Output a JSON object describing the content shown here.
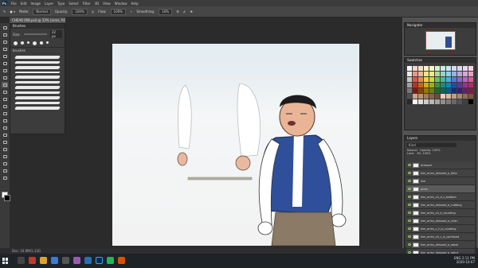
{
  "menu": {
    "app_icon": "Ps",
    "items": [
      "File",
      "Edit",
      "Image",
      "Layer",
      "Type",
      "Select",
      "Filter",
      "3D",
      "View",
      "Window",
      "Help"
    ]
  },
  "options": {
    "mode_label": "Mode:",
    "mode_value": "Normal",
    "opacity_label": "Opacity:",
    "opacity_value": "100%",
    "flow_label": "Flow:",
    "flow_value": "100%",
    "smoothing_label": "Smoothing:",
    "smoothing_value": "10%"
  },
  "document": {
    "tab_title": "CHEAB 008.psd @ 33% (arms, RGB/8)"
  },
  "brushes_panel": {
    "title": "Brushes",
    "size_label": "Size:",
    "size_value": "22 px",
    "folder_label": "brushes"
  },
  "navigator": {
    "title": "Navigator"
  },
  "swatches": {
    "title": "Swatches",
    "colors": [
      "#ffffff",
      "#f4d4cc",
      "#f8e0c8",
      "#fff4c0",
      "#f4f8c8",
      "#d8f0d0",
      "#c8ece4",
      "#c8e8f4",
      "#d0dcf4",
      "#dcd4f0",
      "#ecd4ec",
      "#f4d4e0",
      "#e8e8e8",
      "#e89888",
      "#f0b890",
      "#f8e480",
      "#e4f080",
      "#a8dc98",
      "#90d8c4",
      "#90d0ec",
      "#98b0e8",
      "#b8a4e4",
      "#dca4dc",
      "#ec9cbc",
      "#c8c8c8",
      "#d85848",
      "#e88c48",
      "#f4d040",
      "#c8e040",
      "#64c454",
      "#40bc98",
      "#48b0e0",
      "#5878d8",
      "#8c64d0",
      "#c460c4",
      "#dc5c90",
      "#a0a0a0",
      "#b83024",
      "#c8641c",
      "#d4a818",
      "#98b418",
      "#30983c",
      "#189070",
      "#1880b8",
      "#2848a8",
      "#5c34a0",
      "#983094",
      "#b02c64",
      "#787878",
      "#801810",
      "#904010",
      "#987808",
      "#6c8010",
      "#1c6c28",
      "#0c6850",
      "#0c5a88",
      "#182c7c",
      "#3c1c74",
      "#6c1c6c",
      "#801c44",
      "#505050",
      "#c8a890",
      "#b89478",
      "#a07c60",
      "#886448",
      "#704c34",
      "#e8d0c0",
      "#d8b8a0",
      "#c0a088",
      "#a88870",
      "#907058",
      "#785840",
      "#282828",
      "#f8f8f8",
      "#e0e0e0",
      "#cccccc",
      "#b8b8b8",
      "#a4a4a4",
      "#909090",
      "#7c7c7c",
      "#686868",
      "#545454",
      "#404040",
      "#000000"
    ]
  },
  "layers_panel": {
    "title": "Layers",
    "search_label": "Kind",
    "blend_mode": "Normal",
    "opacity_label": "Opacity: 100%",
    "lock_label": "Lock:",
    "fill_label": "Fill: 100%",
    "layers": [
      {
        "name": "dressed"
      },
      {
        "name": "kim_arms_dressed_a_flats"
      },
      {
        "name": "line"
      },
      {
        "name": "arms",
        "selected": true
      },
      {
        "name": "kim_arms_ch_d_s_bottom"
      },
      {
        "name": "kim_arms_dressed_a_rubbing"
      },
      {
        "name": "kim_arms_ch_e_counting"
      },
      {
        "name": "kim_arms_dressed_a_chan"
      },
      {
        "name": "kim_arms_c_h_b_nodding"
      },
      {
        "name": "kim_arms_ch_c_d_confused"
      },
      {
        "name": "kim_arms_dressed_a_wave"
      },
      {
        "name": "kim_arms_dressed_a_point"
      }
    ]
  },
  "status": {
    "text": "Doc: 24.9M/1.13G"
  },
  "taskbar": {
    "time": "2:11 PM",
    "date": "2020-10-07",
    "lang": "ENG"
  }
}
